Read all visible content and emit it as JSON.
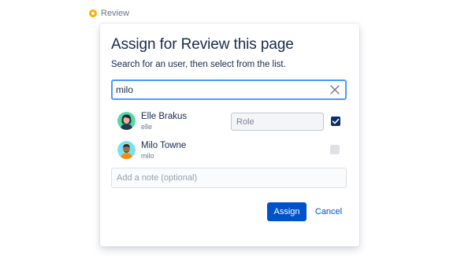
{
  "status": {
    "label": "Review",
    "color": "#ffab00"
  },
  "dialog": {
    "title": "Assign for Review this page",
    "instructions": "Search for an user, then select from the list.",
    "search": {
      "value": "milo"
    },
    "users": [
      {
        "name": "Elle Brakus",
        "handle": "elle",
        "role_placeholder": "Role",
        "checked": true,
        "avatar": "woman-avatar"
      },
      {
        "name": "Milo Towne",
        "handle": "milo",
        "checked": false,
        "avatar": "man-avatar"
      }
    ],
    "note": {
      "placeholder": "Add a note (optional)",
      "value": ""
    },
    "actions": {
      "assign_label": "Assign",
      "cancel_label": "Cancel"
    },
    "colors": {
      "primary": "#0052cc",
      "focus_border": "#4c9aff",
      "checkbox_checked": "#0b2e6b"
    }
  }
}
